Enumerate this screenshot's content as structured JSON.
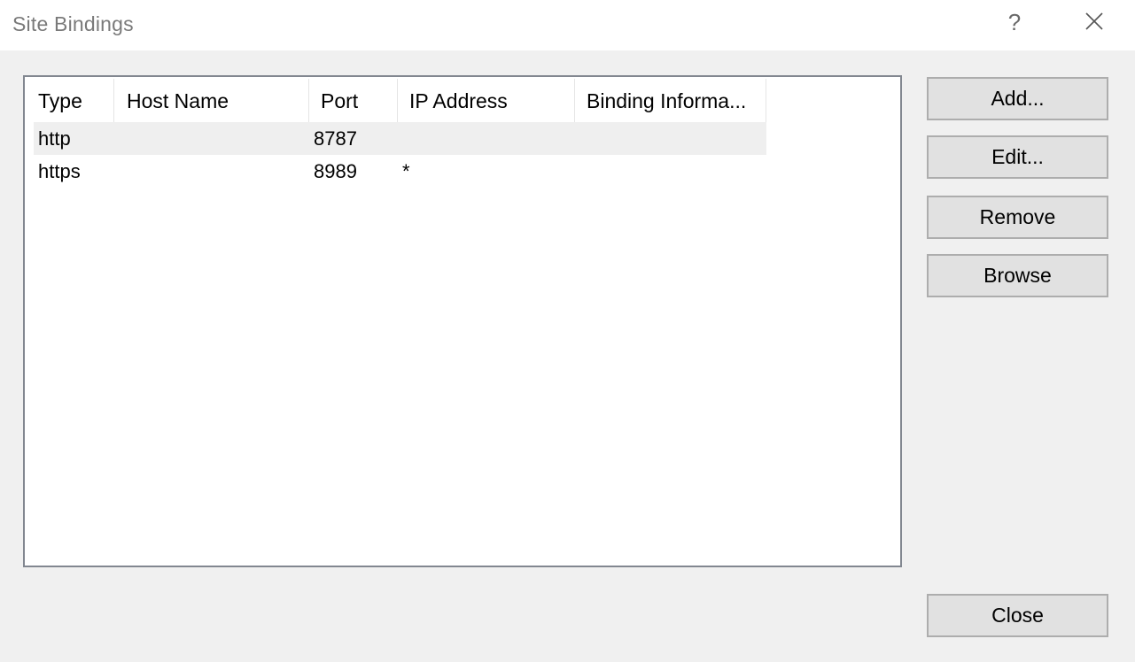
{
  "window": {
    "title": "Site Bindings",
    "help_symbol": "?"
  },
  "table": {
    "columns": [
      "Type",
      "Host Name",
      "Port",
      "IP Address",
      "Binding Informa..."
    ],
    "rows": [
      {
        "type": "http",
        "host_name": "",
        "port": "8787",
        "ip_address": "",
        "binding_information": ""
      },
      {
        "type": "https",
        "host_name": "",
        "port": "8989",
        "ip_address": "*",
        "binding_information": ""
      }
    ],
    "selected_row": 0
  },
  "buttons": {
    "add": "Add...",
    "edit": "Edit...",
    "remove": "Remove",
    "browse": "Browse",
    "close": "Close"
  },
  "icons": {
    "help": "help-icon",
    "close": "close-icon"
  }
}
